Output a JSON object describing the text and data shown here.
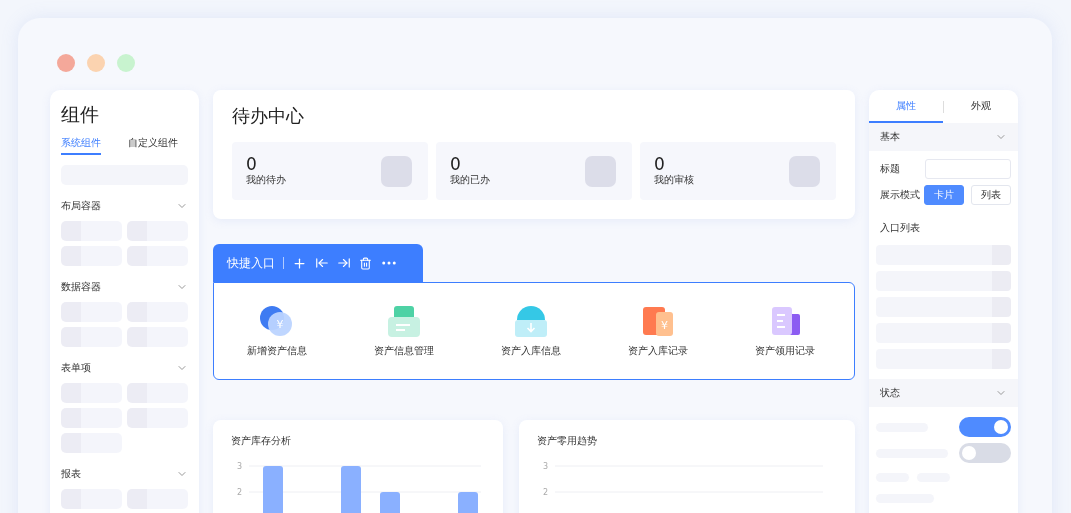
{
  "left_panel": {
    "title": "组件",
    "tabs": [
      {
        "label": "系统组件",
        "selected": true
      },
      {
        "label": "自定义组件",
        "selected": false
      }
    ],
    "sections": [
      {
        "title": "布局容器",
        "expanded": true
      },
      {
        "title": "数据容器",
        "expanded": true
      },
      {
        "title": "表单项",
        "expanded": true
      },
      {
        "title": "报表",
        "expanded": true
      }
    ]
  },
  "todo_card": {
    "title": "待办中心",
    "stats": [
      {
        "value": "0",
        "label": "我的待办"
      },
      {
        "value": "0",
        "label": "我的已办"
      },
      {
        "value": "0",
        "label": "我的审核"
      }
    ]
  },
  "quick_entry": {
    "title": "快捷入口",
    "items": [
      {
        "kind": "coin",
        "symbol": "¥",
        "label": "新增资产信息"
      },
      {
        "kind": "printer",
        "label": "资产信息管理"
      },
      {
        "kind": "download",
        "label": "资产入库信息"
      },
      {
        "kind": "folder",
        "symbol": "¥",
        "label": "资产入库记录"
      },
      {
        "kind": "document",
        "label": "资产领用记录"
      }
    ]
  },
  "charts": [
    {
      "title": "资产库存分析",
      "chart_data": {
        "type": "bar",
        "values": [
          3,
          null,
          3,
          2,
          null,
          2
        ],
        "ylim": [
          0,
          3
        ],
        "yticks": [
          2,
          3
        ],
        "color": "#8ab0ff"
      }
    },
    {
      "title": "资产零用趋势",
      "axis_labels": [
        "3",
        "2"
      ]
    }
  ],
  "right_panel": {
    "tabs": [
      {
        "label": "属性",
        "selected": true
      },
      {
        "label": "外观",
        "selected": false
      }
    ],
    "basic": {
      "title": "基本",
      "expanded": true,
      "title_label": "标题",
      "mode_label": "展示模式",
      "modes": [
        {
          "label": "卡片",
          "selected": true
        },
        {
          "label": "列表",
          "selected": false
        }
      ],
      "list_label": "入口列表"
    },
    "status": {
      "title": "状态",
      "expanded": true,
      "toggles": [
        {
          "on": true
        },
        {
          "on": false
        }
      ]
    }
  }
}
